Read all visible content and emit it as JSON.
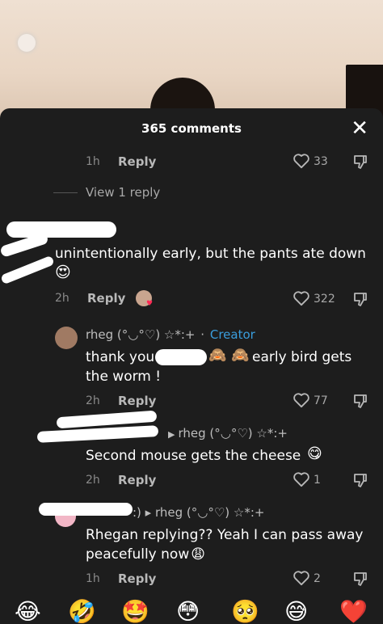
{
  "header": {
    "title": "365 comments",
    "close_glyph": "✕"
  },
  "comment0": {
    "time": "1h",
    "reply": "Reply",
    "likes": "33"
  },
  "view_replies": "View 1 reply",
  "comment1": {
    "text_line1": "unintentionally early, but the pants ate down",
    "text_emoji": "😍",
    "time": "2h",
    "reply": "Reply",
    "likes": "322"
  },
  "reply1": {
    "username": "rheg (°◡°♡) ☆*:+",
    "separator": "·",
    "badge": "Creator",
    "text_a": "thank you",
    "emojis": "🙈 🙈",
    "text_b": "early bird gets",
    "text_line2": "the worm !",
    "time": "2h",
    "reply": "Reply",
    "likes": "77"
  },
  "reply2": {
    "reply_to": "rheg (°◡°♡) ☆*:+",
    "text": "Second mouse gets the cheese",
    "emoji": "😋",
    "time": "2h",
    "reply": "Reply",
    "likes": "1"
  },
  "reply3": {
    "reply_to": ":) ▸ rheg (°◡°♡) ☆*:+",
    "text_line1": "Rhegan replying?? Yeah I can pass away",
    "text_line2": "peacefully now",
    "emoji": "😩",
    "time": "1h",
    "reply": "Reply",
    "likes": "2"
  },
  "emoji_bar": [
    "😂",
    "🤣",
    "🤩",
    "😳",
    "🥺",
    "😅",
    "❤️"
  ]
}
